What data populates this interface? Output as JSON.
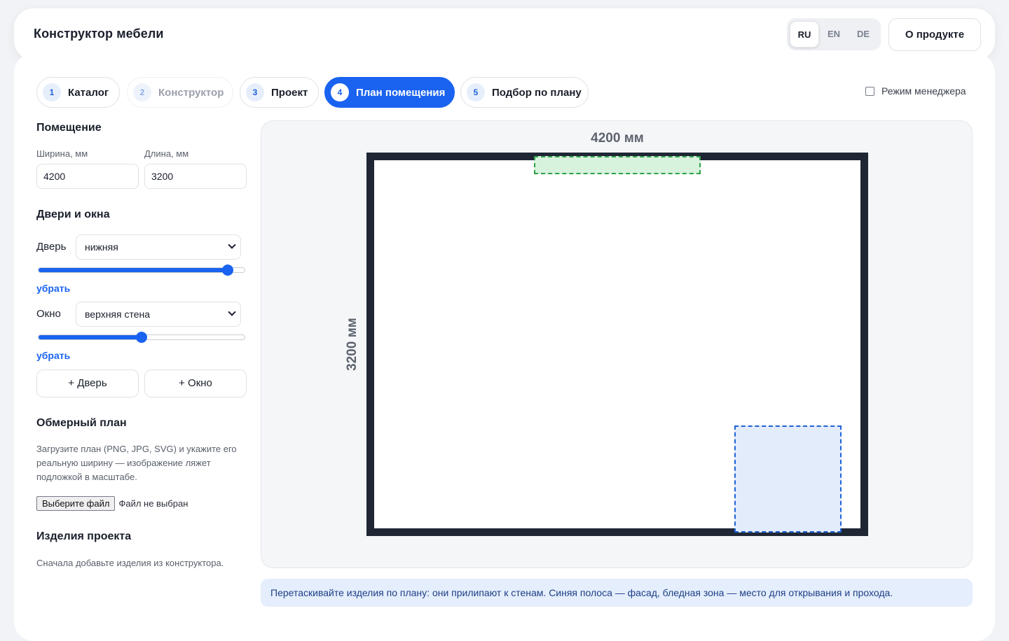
{
  "app": {
    "title": "Конструктор мебели"
  },
  "languages": [
    {
      "code": "RU",
      "active": true
    },
    {
      "code": "EN",
      "active": false
    },
    {
      "code": "DE",
      "active": false
    }
  ],
  "header": {
    "about_label": "О продукте"
  },
  "steps": [
    {
      "num": "1",
      "label": "Каталог",
      "state": "default"
    },
    {
      "num": "2",
      "label": "Конструктор",
      "state": "disabled"
    },
    {
      "num": "3",
      "label": "Проект",
      "state": "default"
    },
    {
      "num": "4",
      "label": "План помещения",
      "state": "active"
    },
    {
      "num": "5",
      "label": "Подбор по плану",
      "state": "default"
    }
  ],
  "manager_mode": {
    "label": "Режим менеджера",
    "checked": false
  },
  "room": {
    "title": "Помещение",
    "width_label": "Ширина, мм",
    "width_value": "4200",
    "length_label": "Длина, мм",
    "length_value": "3200"
  },
  "openings": {
    "title": "Двери и окна",
    "door": {
      "label": "Дверь",
      "selected": "нижняя",
      "position": 0.92,
      "remove_label": "убрать"
    },
    "window": {
      "label": "Окно",
      "selected": "верхняя стена",
      "position": 0.5,
      "remove_label": "убрать"
    },
    "add_door_label": "+ Дверь",
    "add_window_label": "+ Окно"
  },
  "floor_plan": {
    "title": "Обмерный план",
    "description": "Загрузите план (PNG, JPG, SVG) и укажите его реальную ширину — изображение ляжет подложкой в масштабе.",
    "file_button": "Выберите файл",
    "file_status": "Файл не выбран"
  },
  "project_items": {
    "title": "Изделия проекта",
    "empty_text": "Сначала добавьте изделия из конструктора."
  },
  "canvas": {
    "width_dim": "4200 мм",
    "length_dim": "3200 мм",
    "colors": {
      "wall": "#1f2735",
      "window": "#2fa14a",
      "door": "#1f62d8"
    }
  },
  "hint": {
    "text": "Перетаскивайте изделия по плану: они прилипают к стенам. Синяя полоса — фасад, бледная зона — место для открывания и прохода."
  }
}
